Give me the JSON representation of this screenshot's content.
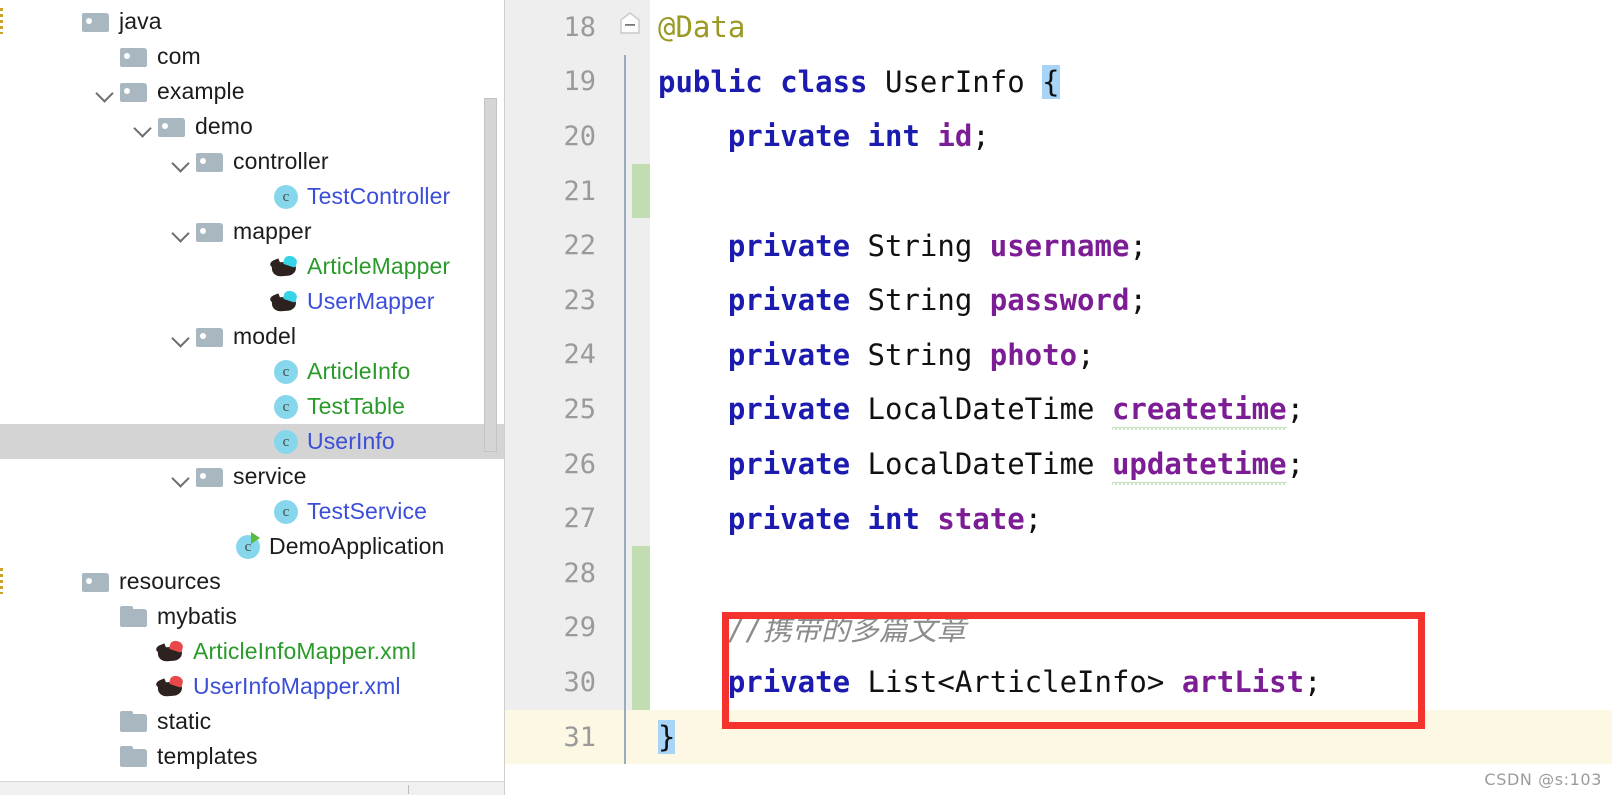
{
  "sidebar": {
    "name": "project-tree",
    "tree": [
      {
        "label": "java",
        "depth": 0,
        "icon": "source-root",
        "chevron": "none",
        "color": "default",
        "selected": false,
        "srcbar": true
      },
      {
        "label": "com",
        "depth": 1,
        "icon": "folder",
        "chevron": "none",
        "color": "default",
        "selected": false,
        "srcbar": false
      },
      {
        "label": "example",
        "depth": 1,
        "icon": "folder",
        "chevron": "open",
        "color": "default",
        "selected": false,
        "srcbar": false
      },
      {
        "label": "demo",
        "depth": 2,
        "icon": "folder",
        "chevron": "open",
        "color": "default",
        "selected": false,
        "srcbar": false
      },
      {
        "label": "controller",
        "depth": 3,
        "icon": "folder",
        "chevron": "open",
        "color": "default",
        "selected": false,
        "srcbar": false
      },
      {
        "label": "TestController",
        "depth": 5,
        "icon": "class",
        "chevron": "none",
        "color": "blue",
        "selected": false,
        "srcbar": false
      },
      {
        "label": "mapper",
        "depth": 3,
        "icon": "folder",
        "chevron": "open",
        "color": "default",
        "selected": false,
        "srcbar": false
      },
      {
        "label": "ArticleMapper",
        "depth": 5,
        "icon": "bird",
        "chevron": "none",
        "color": "green",
        "selected": false,
        "srcbar": false
      },
      {
        "label": "UserMapper",
        "depth": 5,
        "icon": "bird",
        "chevron": "none",
        "color": "blue",
        "selected": false,
        "srcbar": false
      },
      {
        "label": "model",
        "depth": 3,
        "icon": "folder",
        "chevron": "open",
        "color": "default",
        "selected": false,
        "srcbar": false
      },
      {
        "label": "ArticleInfo",
        "depth": 5,
        "icon": "class",
        "chevron": "none",
        "color": "green",
        "selected": false,
        "srcbar": false
      },
      {
        "label": "TestTable",
        "depth": 5,
        "icon": "class",
        "chevron": "none",
        "color": "green",
        "selected": false,
        "srcbar": false
      },
      {
        "label": "UserInfo",
        "depth": 5,
        "icon": "class",
        "chevron": "none",
        "color": "blue",
        "selected": true,
        "srcbar": false
      },
      {
        "label": "service",
        "depth": 3,
        "icon": "folder",
        "chevron": "open",
        "color": "default",
        "selected": false,
        "srcbar": false
      },
      {
        "label": "TestService",
        "depth": 5,
        "icon": "class",
        "chevron": "none",
        "color": "blue",
        "selected": false,
        "srcbar": false
      },
      {
        "label": "DemoApplication",
        "depth": 4,
        "icon": "class-run",
        "chevron": "none",
        "color": "default",
        "selected": false,
        "srcbar": false
      },
      {
        "label": "resources",
        "depth": 0,
        "icon": "source-root",
        "chevron": "none",
        "color": "default",
        "selected": false,
        "srcbar": true
      },
      {
        "label": "mybatis",
        "depth": 1,
        "icon": "folder-plain",
        "chevron": "none",
        "color": "default",
        "selected": false,
        "srcbar": false
      },
      {
        "label": "ArticleInfoMapper.xml",
        "depth": 2,
        "icon": "bird-red",
        "chevron": "none",
        "color": "green",
        "selected": false,
        "srcbar": false
      },
      {
        "label": "UserInfoMapper.xml",
        "depth": 2,
        "icon": "bird-red",
        "chevron": "none",
        "color": "blue",
        "selected": false,
        "srcbar": false
      },
      {
        "label": "static",
        "depth": 1,
        "icon": "folder-plain",
        "chevron": "none",
        "color": "default",
        "selected": false,
        "srcbar": false
      },
      {
        "label": "templates",
        "depth": 1,
        "icon": "folder-plain",
        "chevron": "none",
        "color": "default",
        "selected": false,
        "srcbar": false
      }
    ]
  },
  "editor": {
    "name": "code-editor",
    "file": "UserInfo",
    "lines": [
      {
        "number": "18",
        "caret": false,
        "change": false,
        "guide": false,
        "fold": true,
        "tokens": [
          {
            "t": "ann",
            "v": "@Data"
          }
        ]
      },
      {
        "number": "19",
        "caret": false,
        "change": false,
        "guide": true,
        "fold": false,
        "tokens": [
          {
            "t": "k",
            "v": "public class "
          },
          {
            "t": "t",
            "v": "UserInfo"
          },
          {
            "t": "t",
            "v": " "
          },
          {
            "t": "brace",
            "v": "{"
          }
        ]
      },
      {
        "number": "20",
        "caret": false,
        "change": false,
        "guide": true,
        "fold": false,
        "tokens": [
          {
            "t": "t",
            "v": "    "
          },
          {
            "t": "k",
            "v": "private int "
          },
          {
            "t": "f",
            "v": "id"
          },
          {
            "t": "punc",
            "v": ";"
          }
        ]
      },
      {
        "number": "21",
        "caret": false,
        "change": true,
        "guide": true,
        "fold": false,
        "tokens": []
      },
      {
        "number": "22",
        "caret": false,
        "change": false,
        "guide": true,
        "fold": false,
        "tokens": [
          {
            "t": "t",
            "v": "    "
          },
          {
            "t": "k",
            "v": "private "
          },
          {
            "t": "t",
            "v": "String "
          },
          {
            "t": "f",
            "v": "username"
          },
          {
            "t": "punc",
            "v": ";"
          }
        ]
      },
      {
        "number": "23",
        "caret": false,
        "change": false,
        "guide": true,
        "fold": false,
        "tokens": [
          {
            "t": "t",
            "v": "    "
          },
          {
            "t": "k",
            "v": "private "
          },
          {
            "t": "t",
            "v": "String "
          },
          {
            "t": "f",
            "v": "password"
          },
          {
            "t": "punc",
            "v": ";"
          }
        ]
      },
      {
        "number": "24",
        "caret": false,
        "change": false,
        "guide": true,
        "fold": false,
        "tokens": [
          {
            "t": "t",
            "v": "    "
          },
          {
            "t": "k",
            "v": "private "
          },
          {
            "t": "t",
            "v": "String "
          },
          {
            "t": "f",
            "v": "photo"
          },
          {
            "t": "punc",
            "v": ";"
          }
        ]
      },
      {
        "number": "25",
        "caret": false,
        "change": false,
        "guide": true,
        "fold": false,
        "tokens": [
          {
            "t": "t",
            "v": "    "
          },
          {
            "t": "k",
            "v": "private "
          },
          {
            "t": "t",
            "v": "LocalDateTime "
          },
          {
            "t": "f-typo",
            "v": "createtime"
          },
          {
            "t": "punc",
            "v": ";"
          }
        ]
      },
      {
        "number": "26",
        "caret": false,
        "change": false,
        "guide": true,
        "fold": false,
        "tokens": [
          {
            "t": "t",
            "v": "    "
          },
          {
            "t": "k",
            "v": "private "
          },
          {
            "t": "t",
            "v": "LocalDateTime "
          },
          {
            "t": "f-typo",
            "v": "updatetime"
          },
          {
            "t": "punc",
            "v": ";"
          }
        ]
      },
      {
        "number": "27",
        "caret": false,
        "change": false,
        "guide": true,
        "fold": false,
        "tokens": [
          {
            "t": "t",
            "v": "    "
          },
          {
            "t": "k",
            "v": "private int "
          },
          {
            "t": "f",
            "v": "state"
          },
          {
            "t": "punc",
            "v": ";"
          }
        ]
      },
      {
        "number": "28",
        "caret": false,
        "change": true,
        "guide": true,
        "fold": false,
        "tokens": []
      },
      {
        "number": "29",
        "caret": false,
        "change": true,
        "guide": true,
        "fold": false,
        "tokens": [
          {
            "t": "t",
            "v": "    "
          },
          {
            "t": "cmt",
            "v": "//携带的多篇文章"
          }
        ]
      },
      {
        "number": "30",
        "caret": false,
        "change": true,
        "guide": true,
        "fold": false,
        "tokens": [
          {
            "t": "t",
            "v": "    "
          },
          {
            "t": "k",
            "v": "private "
          },
          {
            "t": "t",
            "v": "List<ArticleInfo> "
          },
          {
            "t": "f",
            "v": "artList"
          },
          {
            "t": "punc",
            "v": ";"
          }
        ]
      },
      {
        "number": "31",
        "caret": true,
        "change": false,
        "guide": true,
        "fold": false,
        "tokens": [
          {
            "t": "brace",
            "v": "}"
          }
        ]
      }
    ]
  },
  "annotation": {
    "name": "red-highlight-box",
    "color": "#f5332e",
    "highlights_lines": [
      "29",
      "30"
    ]
  },
  "watermark": {
    "text": "CSDN @s:103"
  }
}
